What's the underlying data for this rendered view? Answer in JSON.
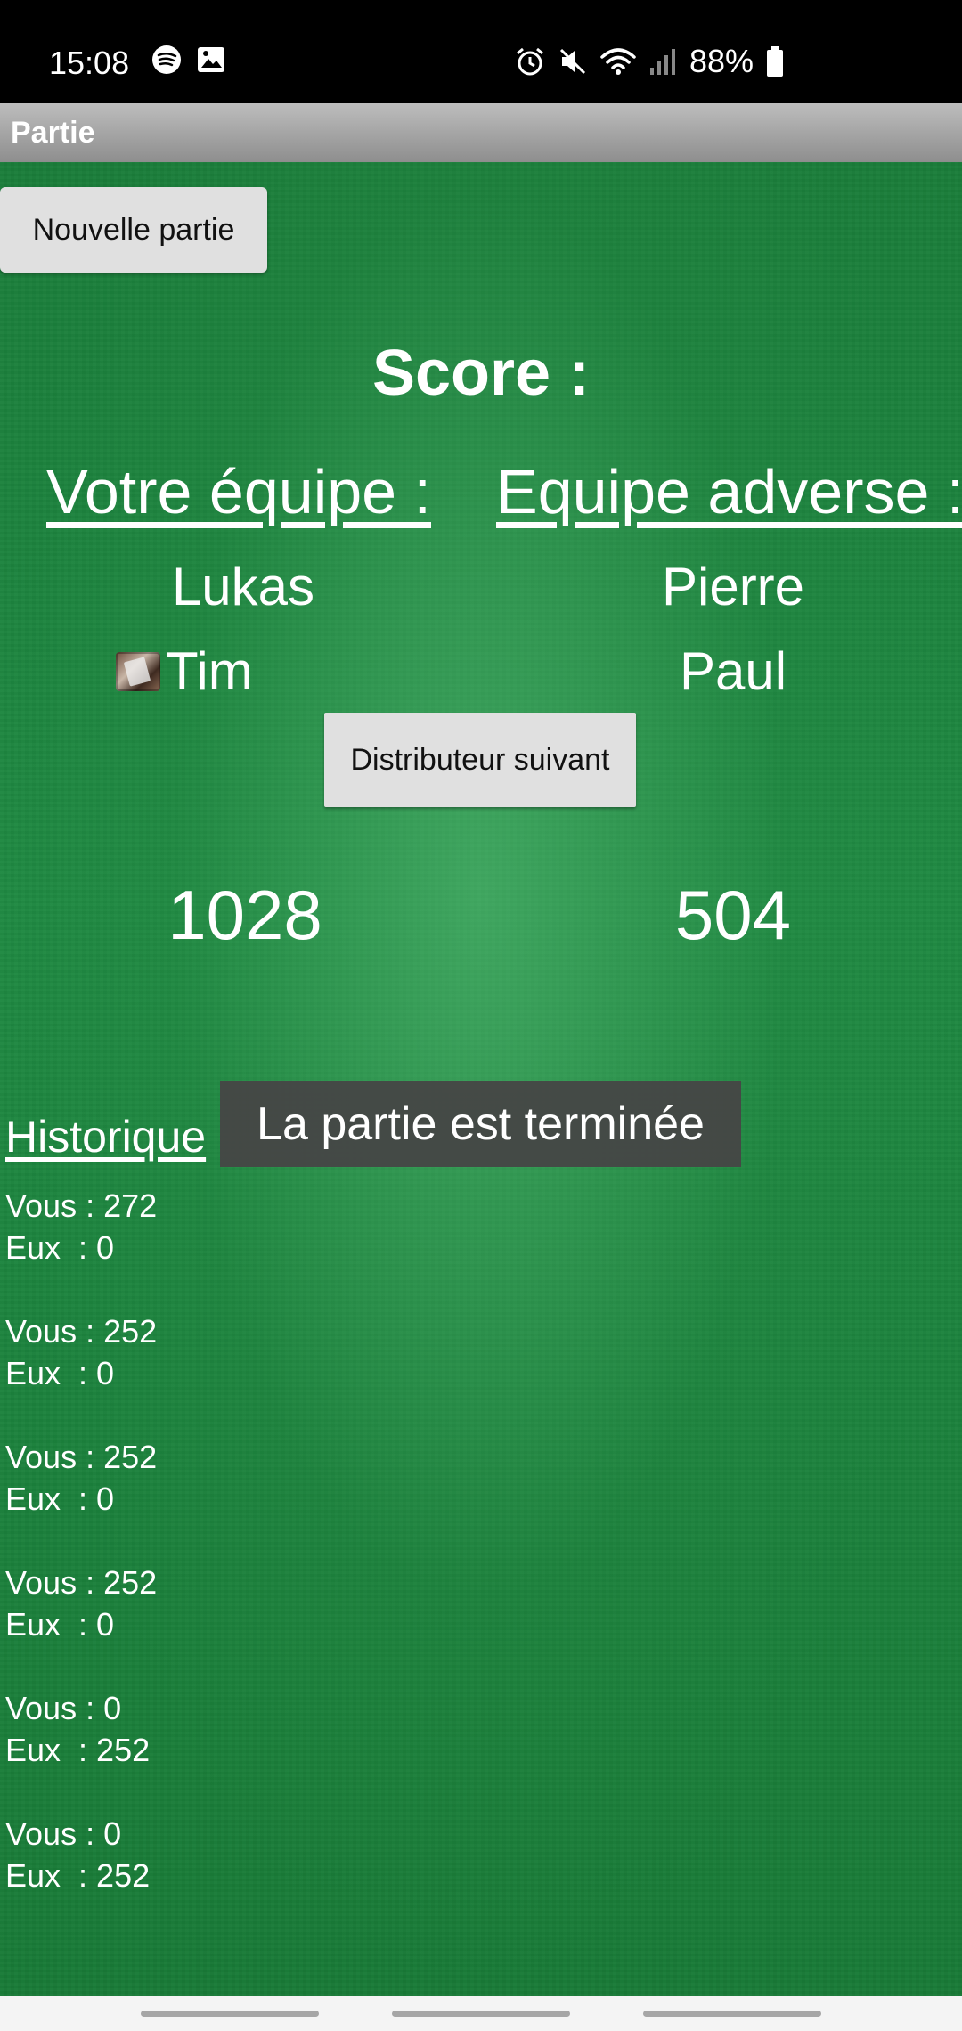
{
  "status_bar": {
    "time": "15:08",
    "battery": "88%",
    "icons": [
      "spotify-icon",
      "image-icon",
      "alarm-icon",
      "mute-icon",
      "wifi-icon",
      "signal-icon",
      "battery-icon"
    ]
  },
  "app_bar": {
    "title": "Partie"
  },
  "buttons": {
    "new_game": "Nouvelle partie",
    "next_dealer": "Distributeur suivant"
  },
  "score": {
    "title": "Score :",
    "team_ours": "Votre équipe :",
    "team_theirs": "Equipe adverse :",
    "players_ours": [
      "Lukas",
      "Tim"
    ],
    "players_theirs": [
      "Pierre",
      "Paul"
    ],
    "total_ours": "1028",
    "total_theirs": "504"
  },
  "history": {
    "title": "Historique",
    "entries": [
      {
        "vous": "Vous : 272",
        "eux": "Eux  : 0"
      },
      {
        "vous": "Vous : 252",
        "eux": "Eux  : 0"
      },
      {
        "vous": "Vous : 252",
        "eux": "Eux  : 0"
      },
      {
        "vous": "Vous : 252",
        "eux": "Eux  : 0"
      },
      {
        "vous": "Vous : 0",
        "eux": "Eux  : 252"
      },
      {
        "vous": "Vous : 0",
        "eux": "Eux  : 252"
      }
    ]
  },
  "toast": "La partie est terminée",
  "colors": {
    "felt": "#1f8a42",
    "toast_bg": "#464646",
    "button_bg": "#e0e0e0"
  }
}
